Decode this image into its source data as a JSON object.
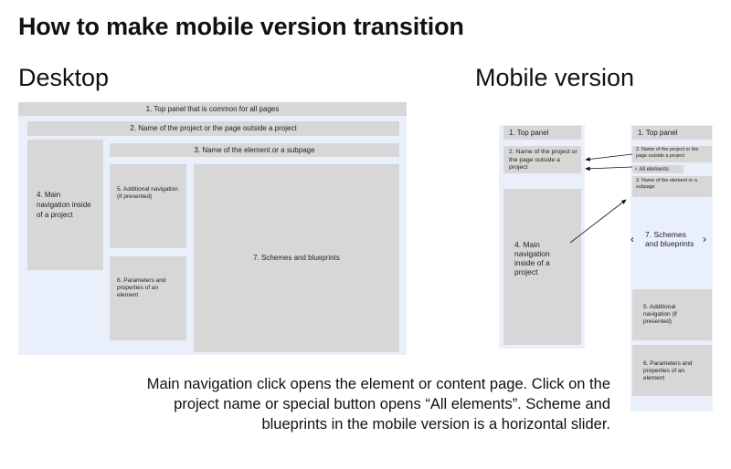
{
  "title": "How to make mobile version transition",
  "desktop": {
    "heading": "Desktop",
    "top_panel": "1. Top panel that is common for all pages",
    "project_name": "2. Name of the project or the page outside a project",
    "element_name": "3. Name of the element or a subpage",
    "main_nav": "4. Main navigation inside of a project",
    "additional_nav": "5. Additiоnal navigation (if presented)",
    "parameters": "6. Parameters and properties of an element",
    "schemes": "7. Schemes and blueprints"
  },
  "mobile": {
    "heading": "Mobile version",
    "screen1": {
      "top_panel": "1. Top panel",
      "project_name": "2. Name of the project or the page outside a project",
      "main_nav": "4. Main navigation inside of a project"
    },
    "screen2": {
      "top_panel": "1. Top panel",
      "project_name": "2. Name of the project or the page outside a project",
      "all_elements": "All elements",
      "element_name": "3. Name of the element or a subpage",
      "schemes": "7. Schemes and blueprints",
      "additional_nav": "5. Additional navigation (if presented)",
      "parameters": "6. Parameters and properties of an element"
    }
  },
  "caption": "Main navigation click opens the element or content page. Click on the project name or special button opens “All elements”. Scheme and blueprints in the mobile version is a horizontal slider.",
  "colors": {
    "frame": "#e9f0fb",
    "box": "#d7d7d7",
    "text": "#111111"
  },
  "icons": [
    "chevron-left-icon",
    "chevron-right-icon",
    "arrow-icon"
  ]
}
